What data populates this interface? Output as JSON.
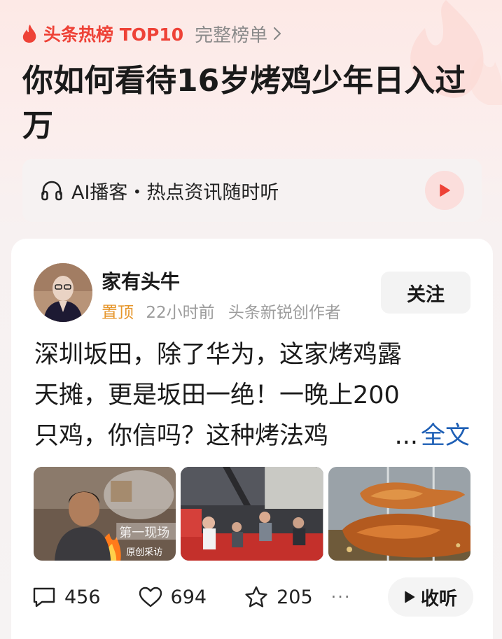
{
  "theme": {
    "accent": "#ee4237",
    "pinned_color": "#e6962b",
    "link_color": "#1e5fb5"
  },
  "hotlist": {
    "title": "头条热榜 TOP10",
    "link_label": "完整榜单",
    "headline": "你如何看待16岁烤鸡少年日入过万",
    "icons": [
      "fire-icon",
      "chevron-right-icon"
    ]
  },
  "podcast": {
    "label": "AI播客・热点资讯随时听",
    "icons": [
      "headphones-icon",
      "play-icon"
    ]
  },
  "post": {
    "author": "家有头牛",
    "pinned_label": "置顶",
    "time": "22小时前",
    "author_badge": "头条新锐创作者",
    "follow_label": "关注",
    "text_lines": [
      "深圳坂田，除了华为，这家烤鸡露",
      "天摊，更是坂田一绝！一晚上200",
      "只鸡，你信吗？这种烤法鸡"
    ],
    "ellipsis": "...",
    "more_label": "全文",
    "thumbnail_overlay": {
      "caption": "原创采访",
      "watermark": "第一现场"
    },
    "stats": {
      "comments": "456",
      "likes": "694",
      "favorites": "205",
      "more": "···"
    },
    "listen_label": "收听",
    "icons": [
      "comment-icon",
      "heart-icon",
      "star-icon",
      "play-icon"
    ]
  }
}
